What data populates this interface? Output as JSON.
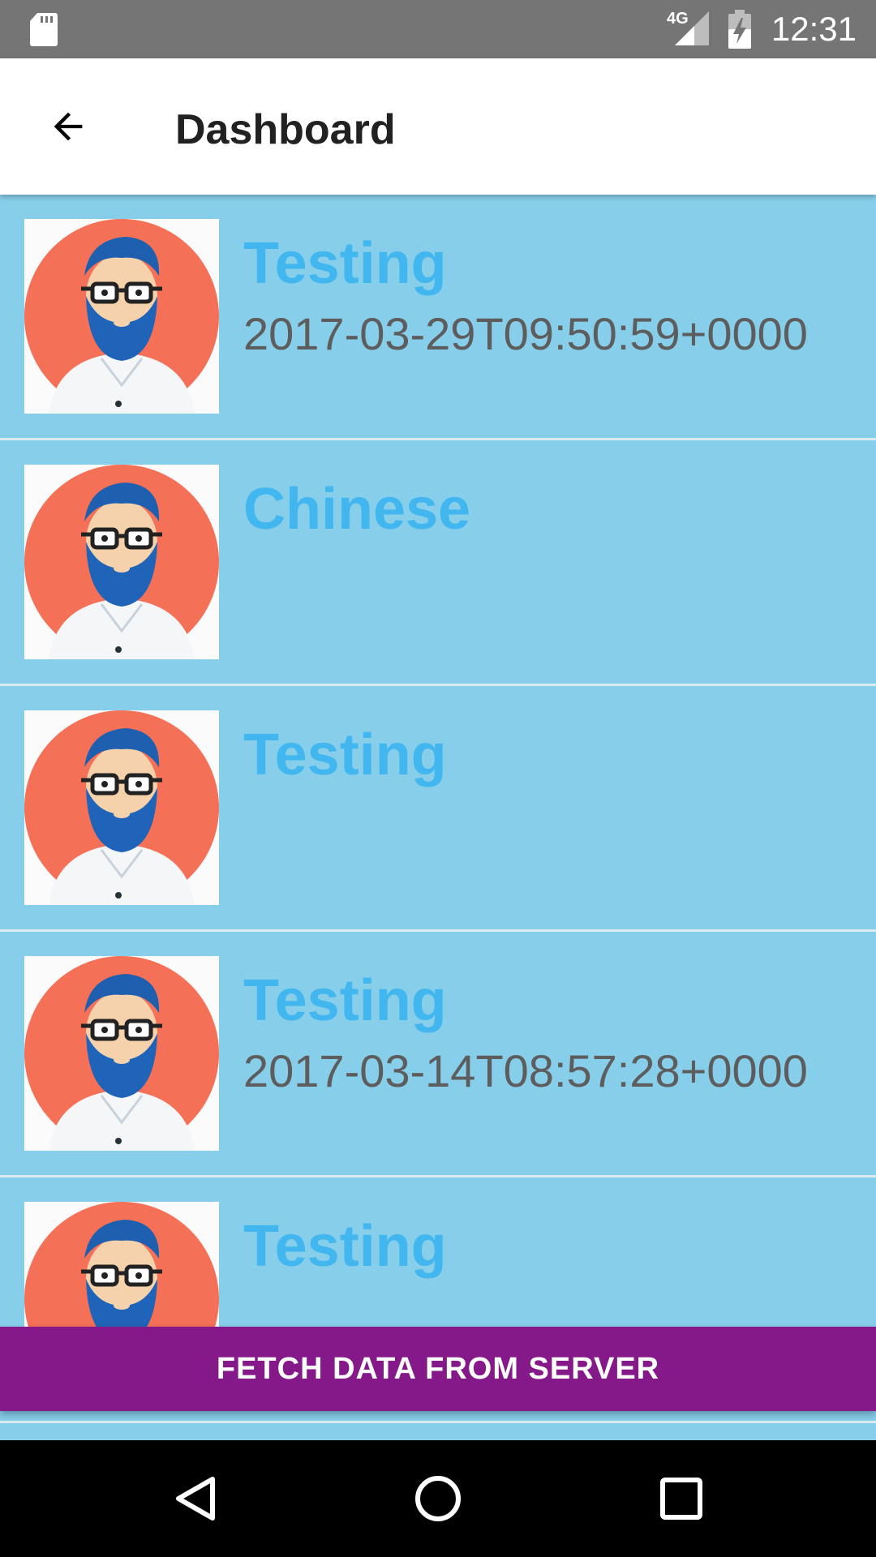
{
  "status_bar": {
    "time": "12:31",
    "network": "4G",
    "icons": [
      "sd-card-icon",
      "signal-icon",
      "battery-charging-icon"
    ]
  },
  "app_bar": {
    "title": "Dashboard",
    "back_icon": "arrow-back-icon"
  },
  "list": {
    "items": [
      {
        "title": "Testing",
        "subtitle": "2017-03-29T09:50:59+0000",
        "avatar": "bearded-man-avatar"
      },
      {
        "title": "Chinese",
        "subtitle": "",
        "avatar": "bearded-man-avatar"
      },
      {
        "title": "Testing",
        "subtitle": "",
        "avatar": "bearded-man-avatar"
      },
      {
        "title": "Testing",
        "subtitle": "2017-03-14T08:57:28+0000",
        "avatar": "bearded-man-avatar"
      },
      {
        "title": "Testing",
        "subtitle": "",
        "avatar": "bearded-man-avatar"
      }
    ]
  },
  "fetch_button": {
    "label": "FETCH DATA FROM SERVER"
  },
  "nav_bar": {
    "icons": [
      "nav-back-icon",
      "nav-home-icon",
      "nav-recents-icon"
    ]
  },
  "colors": {
    "list_background": "#87ceeb",
    "item_title": "#42b6ee",
    "item_subtitle": "#5d5d5d",
    "button_background": "#86198a",
    "status_bar": "#757575"
  }
}
